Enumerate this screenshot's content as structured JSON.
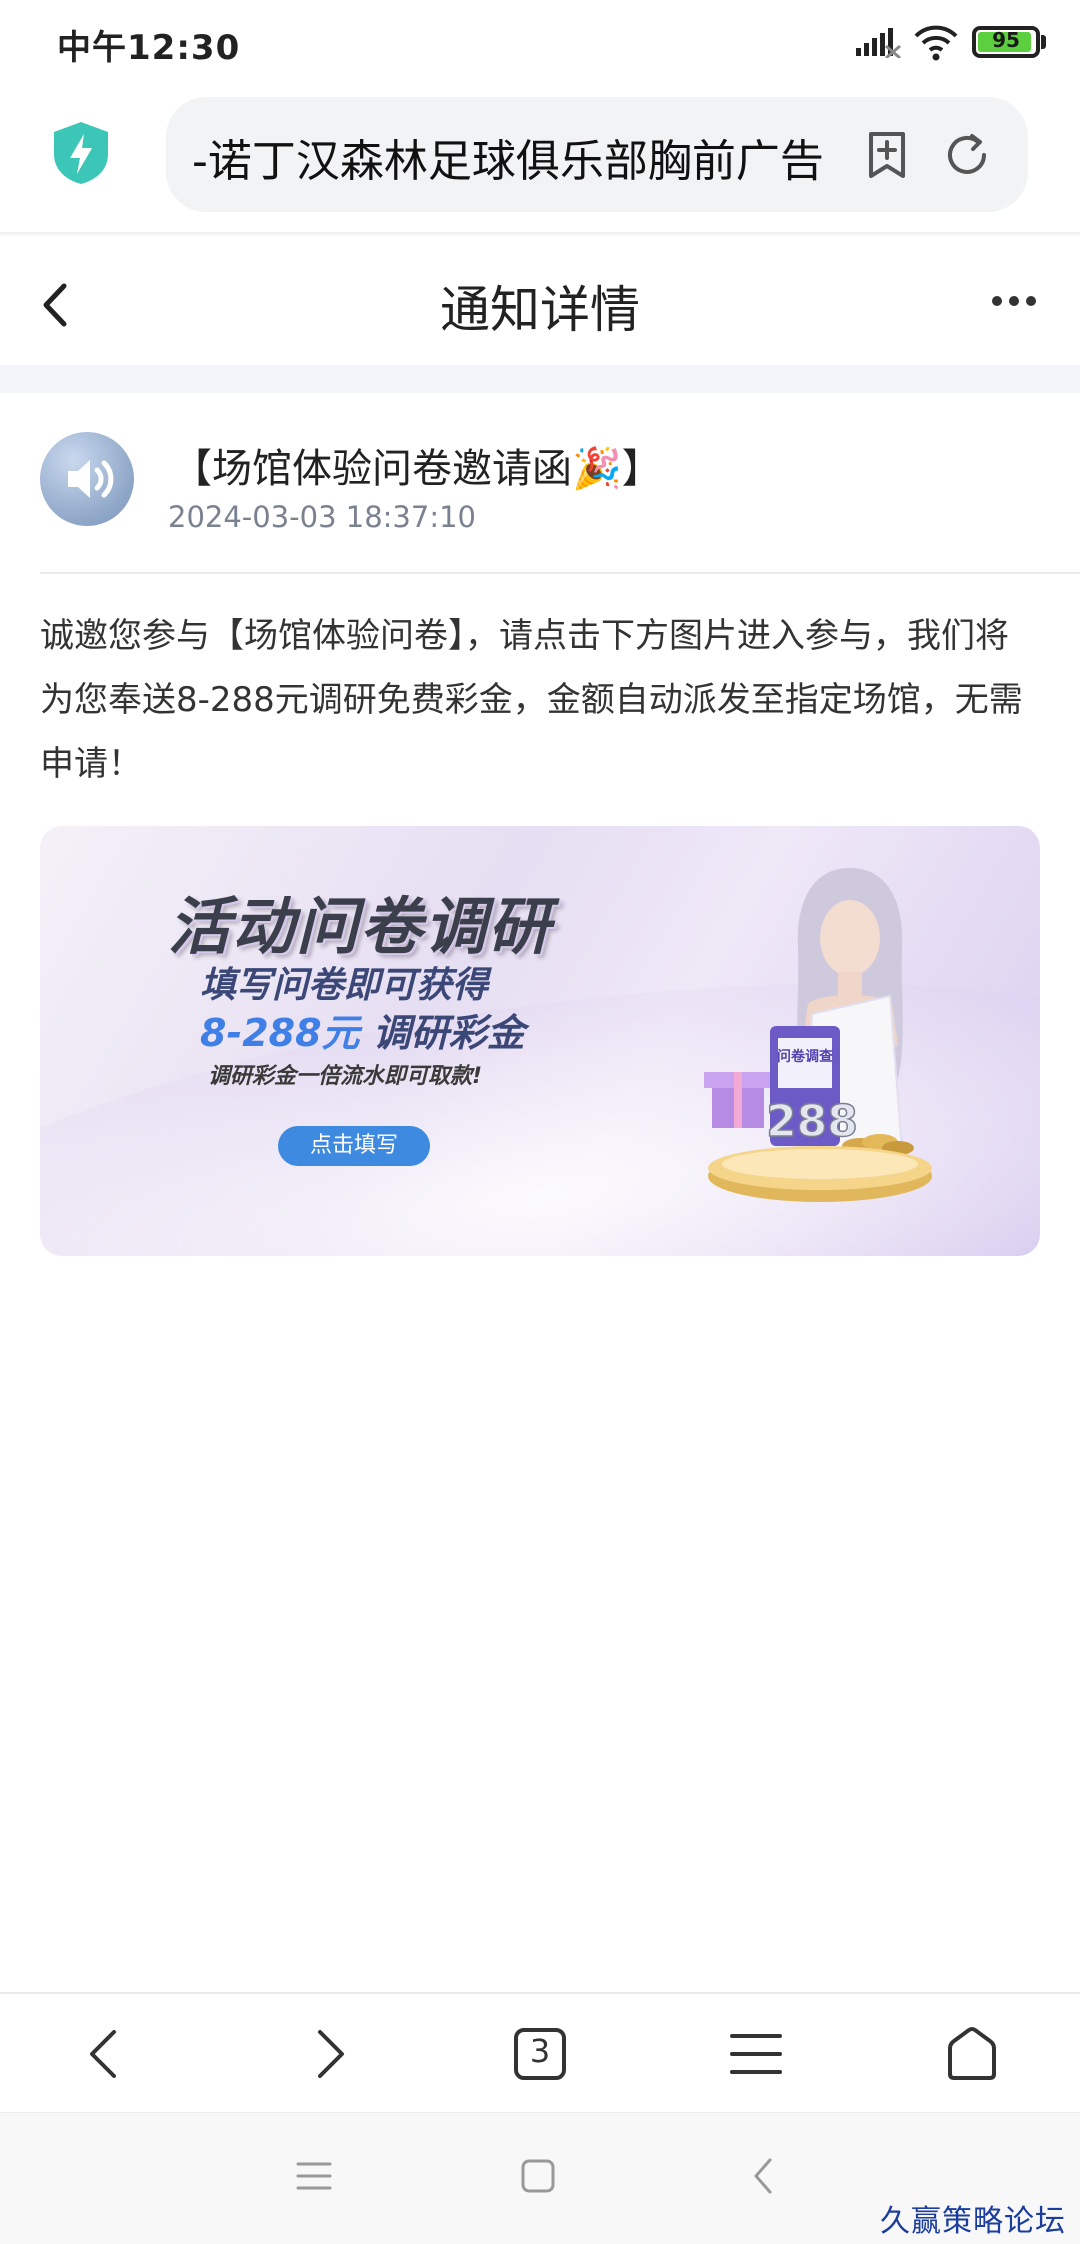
{
  "status_bar": {
    "time": "中午12:30",
    "battery_level": "95",
    "battery_color": "#5ccf3f"
  },
  "browser": {
    "url_text": "-诺丁汉森林足球俱乐部胸前广告",
    "icons": [
      "shield-bolt-icon",
      "add-bookmark-icon",
      "reload-icon"
    ]
  },
  "header": {
    "title": "通知详情"
  },
  "notice": {
    "title": "【场馆体验问卷邀请函🎉】",
    "date": "2024-03-03 18:37:10",
    "body": "诚邀您参与【场馆体验问卷】，请点击下方图片进入参与，我们将为您奉送8-288元调研免费彩金，金额自动派发至指定场馆，无需申请！"
  },
  "banner": {
    "title": "活动问卷调研",
    "subtitle_line1": "填写问卷即可获得",
    "amount": "8-288元",
    "subtitle_tail": "调研彩金",
    "note": "调研彩金一倍流水即可取款!",
    "button_label": "点击填写",
    "calendar_text": "问卷调查",
    "calendar_number": "288"
  },
  "toolbar": {
    "tab_count": "3"
  },
  "watermark": "久赢策略论坛",
  "colors": {
    "accent_blue": "#3d8ae0",
    "shield": "#3cc6b8"
  }
}
